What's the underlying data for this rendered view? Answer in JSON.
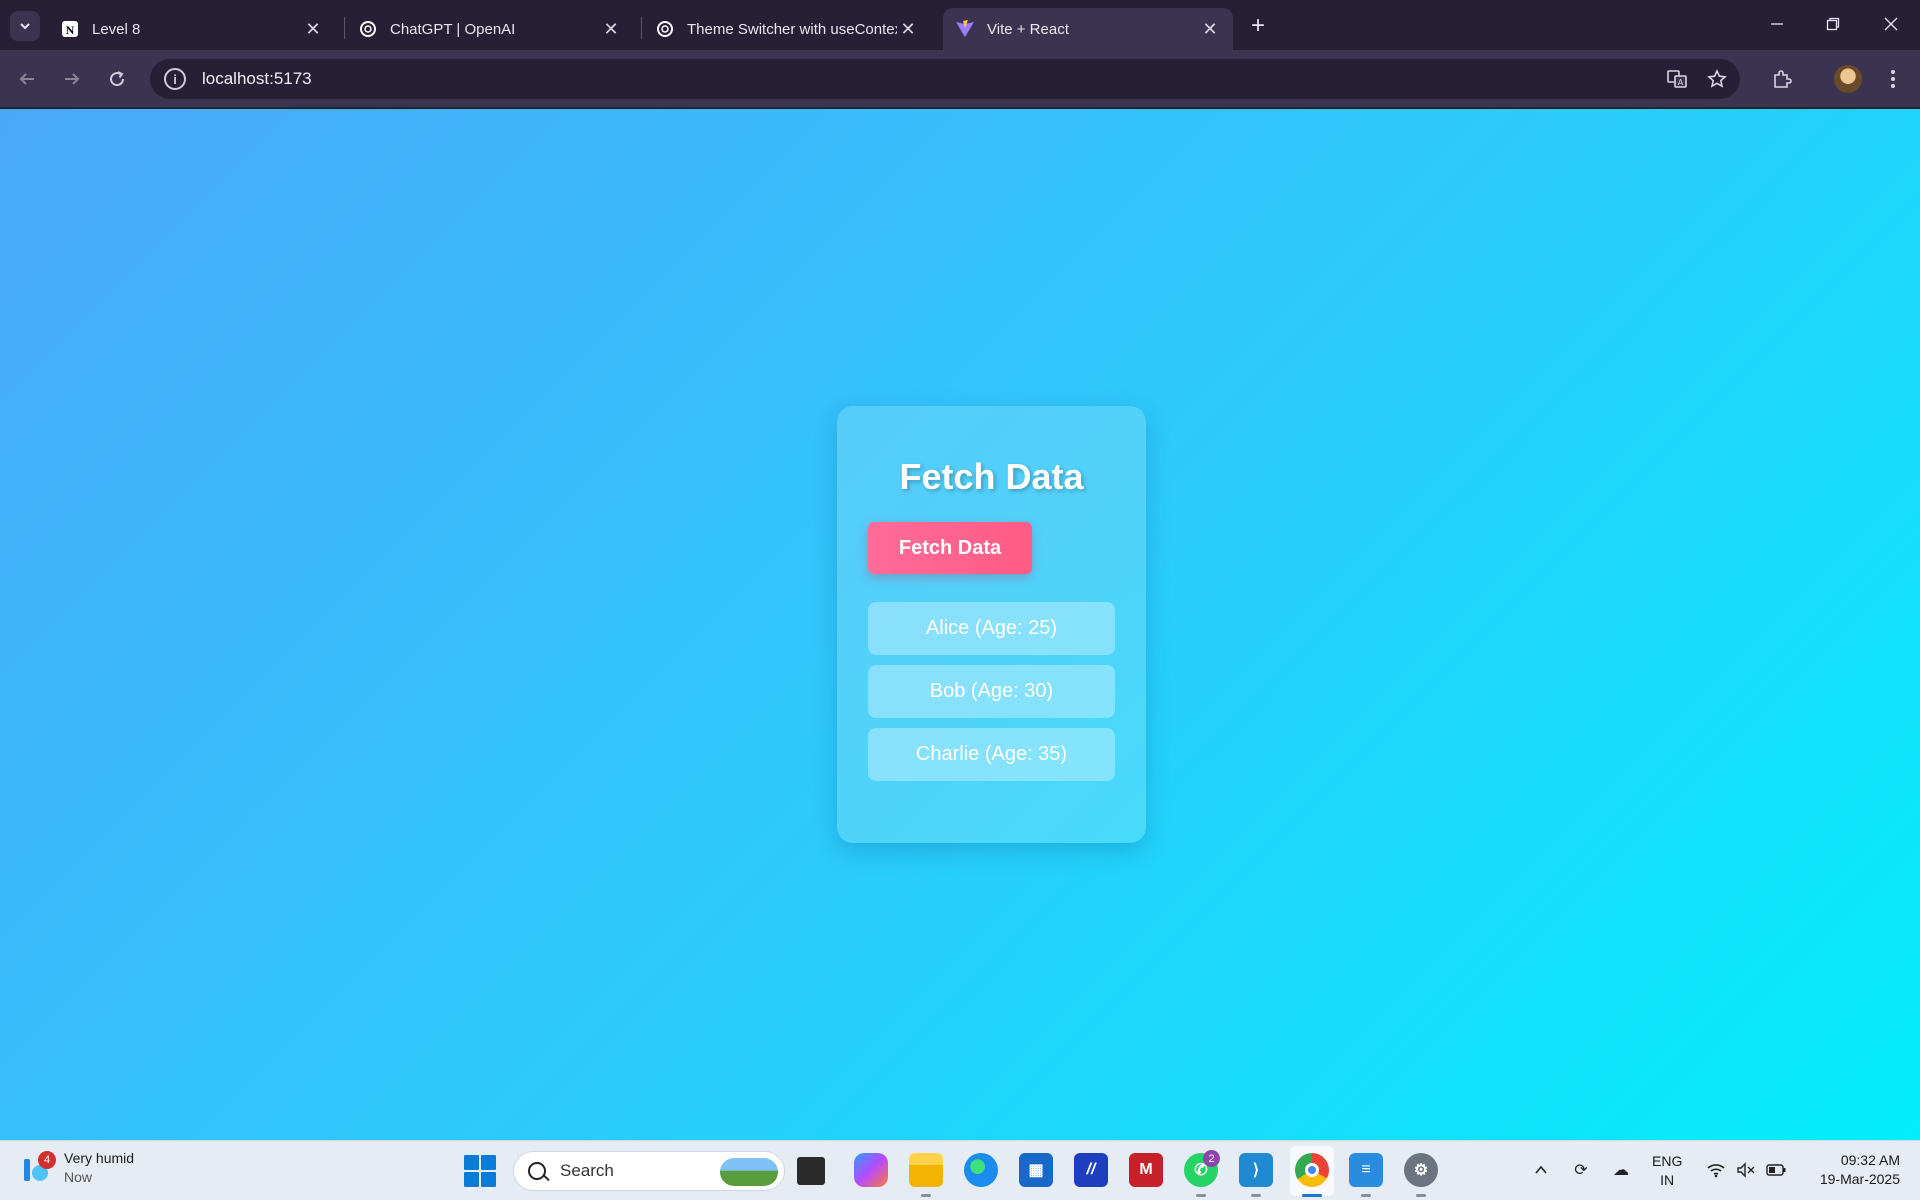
{
  "browser": {
    "tabs": [
      {
        "title": "Level 8",
        "icon": "notion-icon",
        "active": false
      },
      {
        "title": "ChatGPT | OpenAI",
        "icon": "openai-icon",
        "active": false
      },
      {
        "title": "Theme Switcher with useContex",
        "icon": "openai-icon",
        "active": false
      },
      {
        "title": "Vite + React",
        "icon": "vite-icon",
        "active": true
      }
    ],
    "address": "localhost:5173"
  },
  "page": {
    "title": "Fetch Data",
    "button_label": "Fetch Data",
    "users": [
      "Alice (Age: 25)",
      "Bob (Age: 30)",
      "Charlie (Age: 35)"
    ],
    "colors": {
      "gradient_start": "#4aa8fb",
      "gradient_end": "#03eefb",
      "button": "#ff5b84"
    }
  },
  "taskbar": {
    "weather": {
      "label": "Very humid",
      "sub": "Now",
      "badge": "4"
    },
    "search_placeholder": "Search",
    "whatsapp_badge": "2",
    "language": {
      "line1": "ENG",
      "line2": "IN"
    },
    "clock": {
      "time": "09:32 AM",
      "date": "19-Mar-2025"
    }
  }
}
